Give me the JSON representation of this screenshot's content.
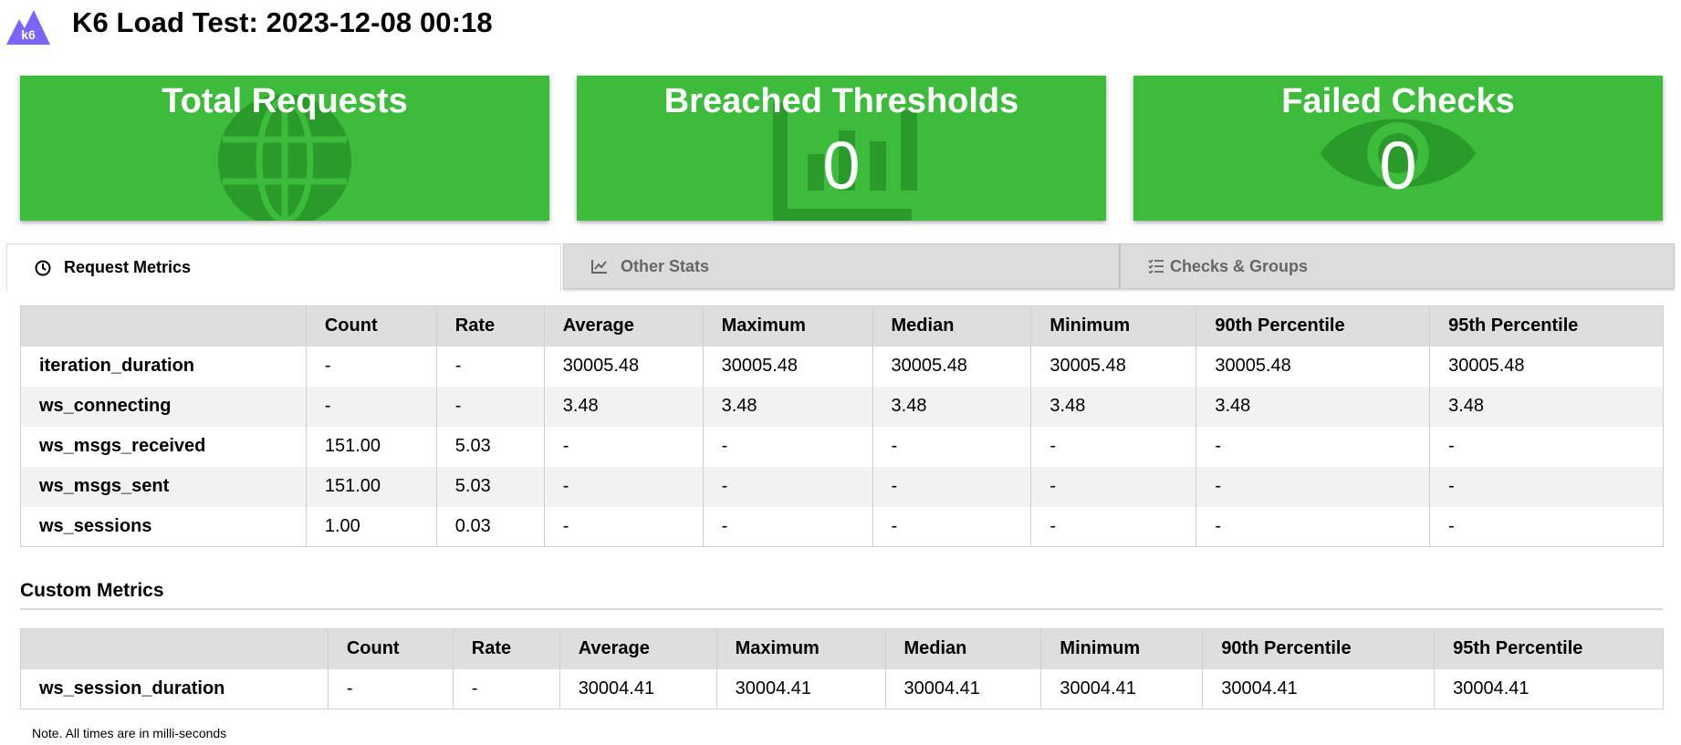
{
  "header": {
    "title": "K6 Load Test: 2023-12-08 00:18",
    "logo_text": "k6"
  },
  "cards": [
    {
      "title": "Total Requests",
      "value": "",
      "icon": "globe-icon"
    },
    {
      "title": "Breached Thresholds",
      "value": "0",
      "icon": "bar-chart-icon"
    },
    {
      "title": "Failed Checks",
      "value": "0",
      "icon": "eye-icon"
    }
  ],
  "tabs": [
    {
      "label": "Request Metrics",
      "icon": "clock-icon",
      "active": true
    },
    {
      "label": "Other Stats",
      "icon": "line-chart-icon",
      "active": false
    },
    {
      "label": "Checks & Groups",
      "icon": "list-check-icon",
      "active": false
    }
  ],
  "request_metrics": {
    "columns": [
      "",
      "Count",
      "Rate",
      "Average",
      "Maximum",
      "Median",
      "Minimum",
      "90th Percentile",
      "95th Percentile"
    ],
    "rows": [
      [
        "iteration_duration",
        "-",
        "-",
        "30005.48",
        "30005.48",
        "30005.48",
        "30005.48",
        "30005.48",
        "30005.48"
      ],
      [
        "ws_connecting",
        "-",
        "-",
        "3.48",
        "3.48",
        "3.48",
        "3.48",
        "3.48",
        "3.48"
      ],
      [
        "ws_msgs_received",
        "151.00",
        "5.03",
        "-",
        "-",
        "-",
        "-",
        "-",
        "-"
      ],
      [
        "ws_msgs_sent",
        "151.00",
        "5.03",
        "-",
        "-",
        "-",
        "-",
        "-",
        "-"
      ],
      [
        "ws_sessions",
        "1.00",
        "0.03",
        "-",
        "-",
        "-",
        "-",
        "-",
        "-"
      ]
    ]
  },
  "custom_metrics": {
    "title": "Custom Metrics",
    "columns": [
      "",
      "Count",
      "Rate",
      "Average",
      "Maximum",
      "Median",
      "Minimum",
      "90th Percentile",
      "95th Percentile"
    ],
    "rows": [
      [
        "ws_session_duration",
        "-",
        "-",
        "30004.41",
        "30004.41",
        "30004.41",
        "30004.41",
        "30004.41",
        "30004.41"
      ]
    ]
  },
  "note": "Note. All times are in milli-seconds",
  "colors": {
    "card_green": "#3cbc3a",
    "card_icon_green": "#2a9a2a",
    "logo_purple": "#7d64ff",
    "tab_inactive": "#dcdcdc"
  }
}
